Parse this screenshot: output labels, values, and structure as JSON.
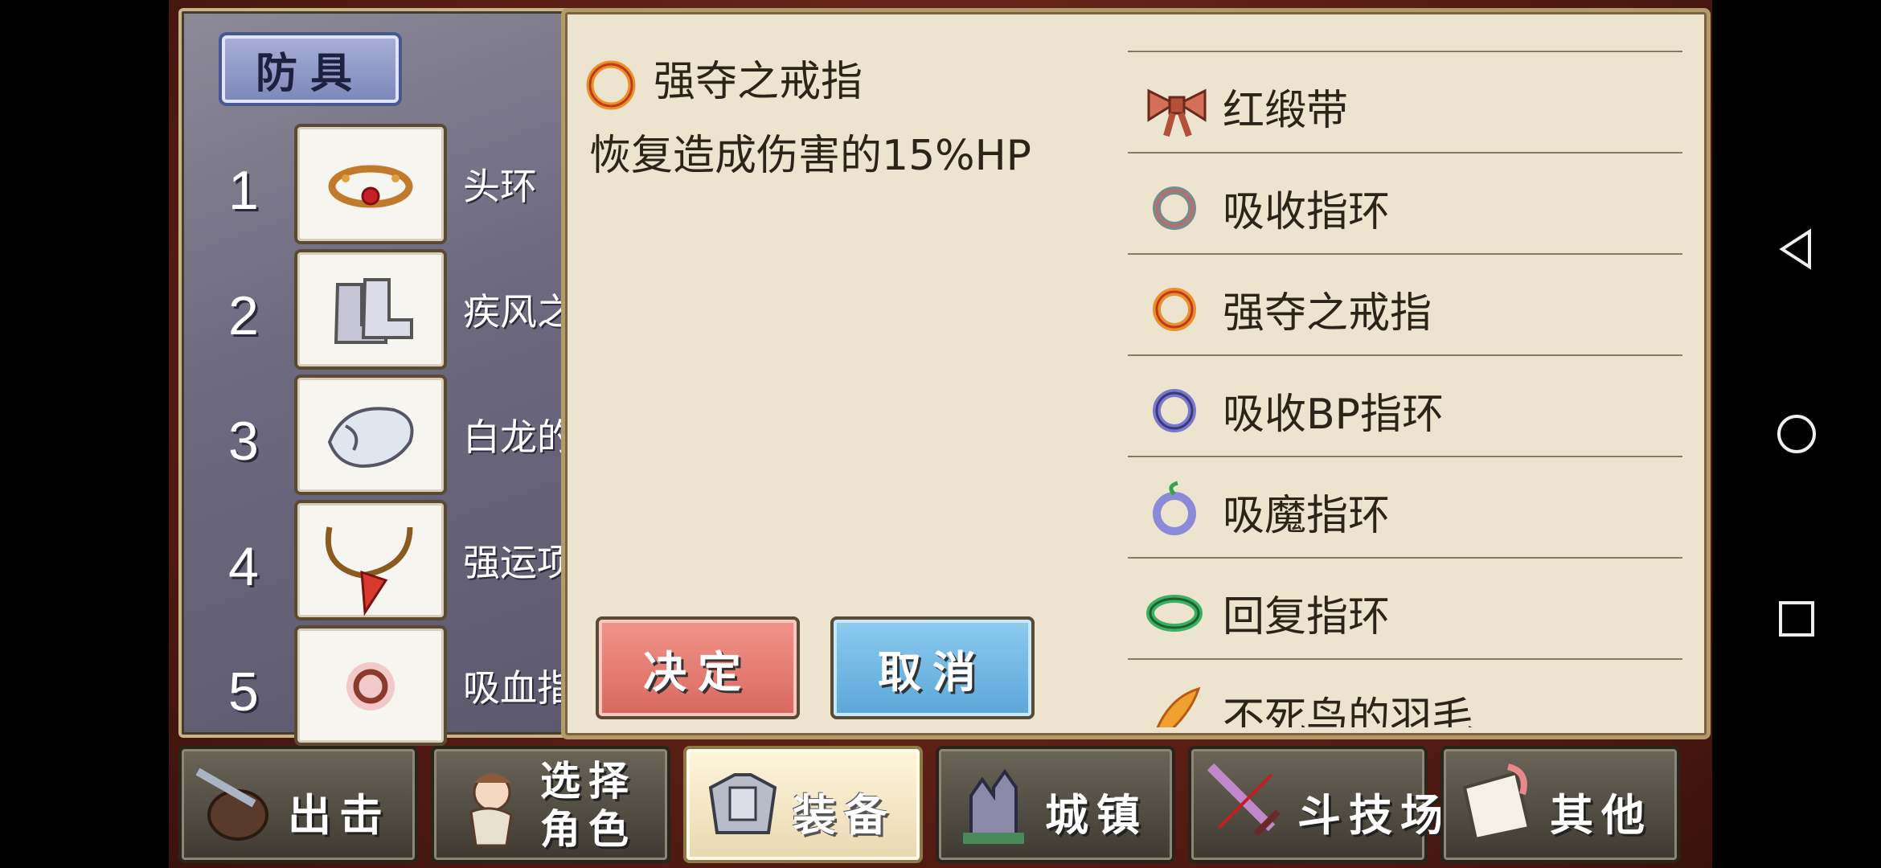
{
  "left_panel": {
    "title": "防具",
    "slots": [
      {
        "num": "1",
        "name": "头环",
        "icon": "circlet-icon"
      },
      {
        "num": "2",
        "name": "疾风之",
        "icon": "boots-icon"
      },
      {
        "num": "3",
        "name": "白龙的",
        "icon": "dragon-icon"
      },
      {
        "num": "4",
        "name": "强运项",
        "icon": "necklace-icon"
      },
      {
        "num": "5",
        "name": "吸血指",
        "icon": "vampire-ring-icon"
      }
    ]
  },
  "detail": {
    "name": "强夺之戒指",
    "description": "恢复造成伤害的15%HP",
    "icon": "plunder-ring-icon"
  },
  "buttons": {
    "confirm": "决定",
    "cancel": "取消"
  },
  "item_list": [
    {
      "label": "红缎带",
      "icon": "ribbon-icon"
    },
    {
      "label": "吸收指环",
      "icon": "absorb-ring-icon"
    },
    {
      "label": "强夺之戒指",
      "icon": "plunder-ring-icon"
    },
    {
      "label": "吸收BP指环",
      "icon": "absorb-bp-ring-icon"
    },
    {
      "label": "吸魔指环",
      "icon": "absorb-magic-ring-icon"
    },
    {
      "label": "回复指环",
      "icon": "recovery-ring-icon"
    },
    {
      "label": "不死鸟的羽毛",
      "icon": "phoenix-feather-icon"
    }
  ],
  "nav": [
    {
      "label": "出击",
      "icon": "sortie-icon"
    },
    {
      "label": "选择\n角色",
      "icon": "character-icon"
    },
    {
      "label": "装备",
      "icon": "armor-icon",
      "active": true
    },
    {
      "label": "城镇",
      "icon": "castle-icon"
    },
    {
      "label": "斗技场",
      "icon": "sword-icon"
    },
    {
      "label": "其他",
      "icon": "scroll-icon"
    }
  ],
  "system_nav": [
    "back-icon",
    "home-icon",
    "recents-icon"
  ],
  "colors": {
    "dialog_bg": "#ece4cf",
    "confirm_btn": "#e27b72",
    "cancel_btn": "#6fb6e2",
    "frame": "#5a1e14"
  }
}
